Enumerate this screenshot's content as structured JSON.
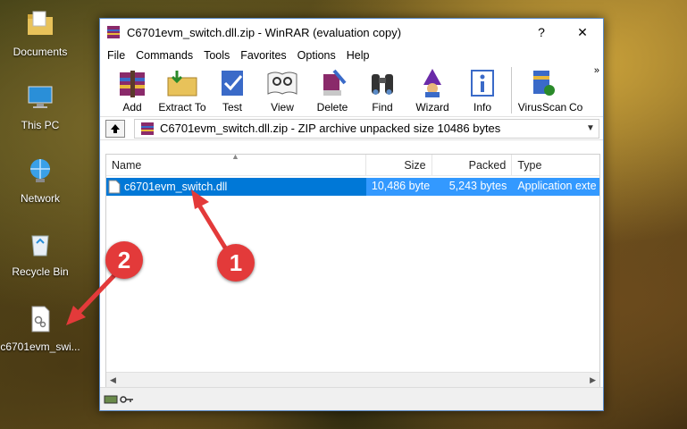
{
  "desktop": {
    "icons": [
      {
        "label": "Documents",
        "icon": "folder-icon"
      },
      {
        "label": "This PC",
        "icon": "computer-icon"
      },
      {
        "label": "Network",
        "icon": "network-icon"
      },
      {
        "label": "Recycle Bin",
        "icon": "recycle-bin-icon"
      },
      {
        "label": "c6701evm_swi...",
        "icon": "dll-file-icon"
      }
    ]
  },
  "window": {
    "title": "C6701evm_switch.dll.zip - WinRAR (evaluation copy)",
    "help_btn": "?",
    "close_btn": "✕"
  },
  "menu": [
    "File",
    "Commands",
    "Tools",
    "Favorites",
    "Options",
    "Help"
  ],
  "toolbar": {
    "buttons": [
      "Add",
      "Extract To",
      "Test",
      "View",
      "Delete",
      "Find",
      "Wizard",
      "Info",
      "VirusScan",
      "Co"
    ],
    "more": "»"
  },
  "pathbar": {
    "path": "C6701evm_switch.dll.zip - ZIP archive unpacked size 10486 bytes"
  },
  "filelist": {
    "columns": [
      "Name",
      "Size",
      "Packed",
      "Type"
    ],
    "rows": [
      {
        "name": "c6701evm_switch.dll",
        "size": "10,486 byte",
        "packed": "5,243 bytes",
        "type": "Application exte"
      }
    ]
  },
  "annotations": {
    "badge_1": "1",
    "badge_2": "2",
    "color": "#e33a3a"
  },
  "colors": {
    "selection": "#3399ff",
    "selection_name": "#0078d7",
    "window_border": "#5a8ac6"
  }
}
